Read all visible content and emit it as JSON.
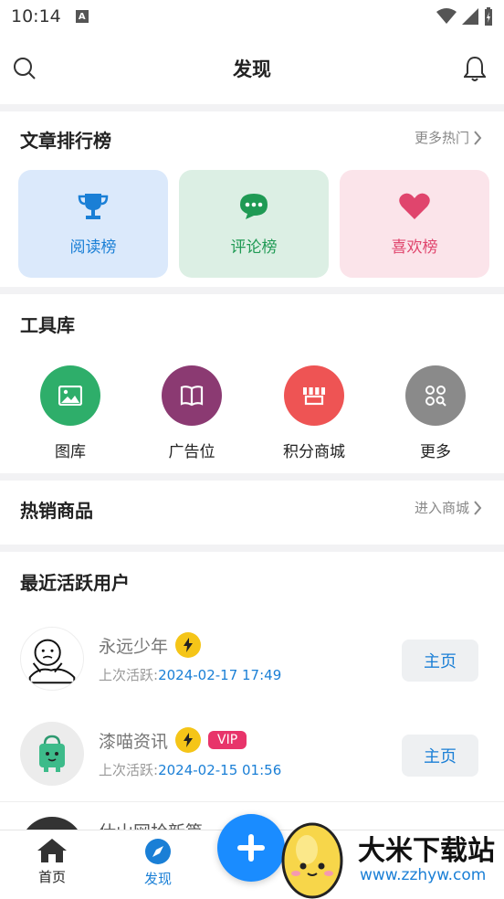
{
  "status_bar": {
    "time": "10:14",
    "notif_letter": "A"
  },
  "header": {
    "title": "发现"
  },
  "ranking": {
    "title": "文章排行榜",
    "more": "更多热门",
    "items": [
      {
        "label": "阅读榜",
        "icon": "trophy-icon",
        "bg": "#dbe9fb",
        "color": "#1a7fd6"
      },
      {
        "label": "评论榜",
        "icon": "comment-bubble-icon",
        "bg": "#dcefe4",
        "color": "#1f9a54"
      },
      {
        "label": "喜欢榜",
        "icon": "heart-icon",
        "bg": "#fbe4ea",
        "color": "#e0456d"
      }
    ]
  },
  "tools": {
    "title": "工具库",
    "items": [
      {
        "label": "图库",
        "icon": "image-icon",
        "color": "#2eae6a"
      },
      {
        "label": "广告位",
        "icon": "book-icon",
        "color": "#8b3a72"
      },
      {
        "label": "积分商城",
        "icon": "store-icon",
        "color": "#ee5454"
      },
      {
        "label": "更多",
        "icon": "more-grid-icon",
        "color": "#8a8a8a"
      }
    ]
  },
  "hot_goods": {
    "title": "热销商品",
    "more": "进入商城"
  },
  "active_users": {
    "title": "最近活跃用户",
    "last_active_label": "上次活跃:",
    "home_label": "主页",
    "users": [
      {
        "name": "永远少年",
        "vip": "",
        "date": "2024-02-17 17:49"
      },
      {
        "name": "漆喵资讯",
        "vip": "VIP",
        "date": "2024-02-15 01:56"
      },
      {
        "name": "仕山网拾新篇",
        "vip": "",
        "date": ""
      }
    ]
  },
  "tabbar": {
    "home": "首页",
    "discover": "发现"
  },
  "watermark": {
    "title": "大米下载站",
    "url": "www.zzhyw.com"
  }
}
